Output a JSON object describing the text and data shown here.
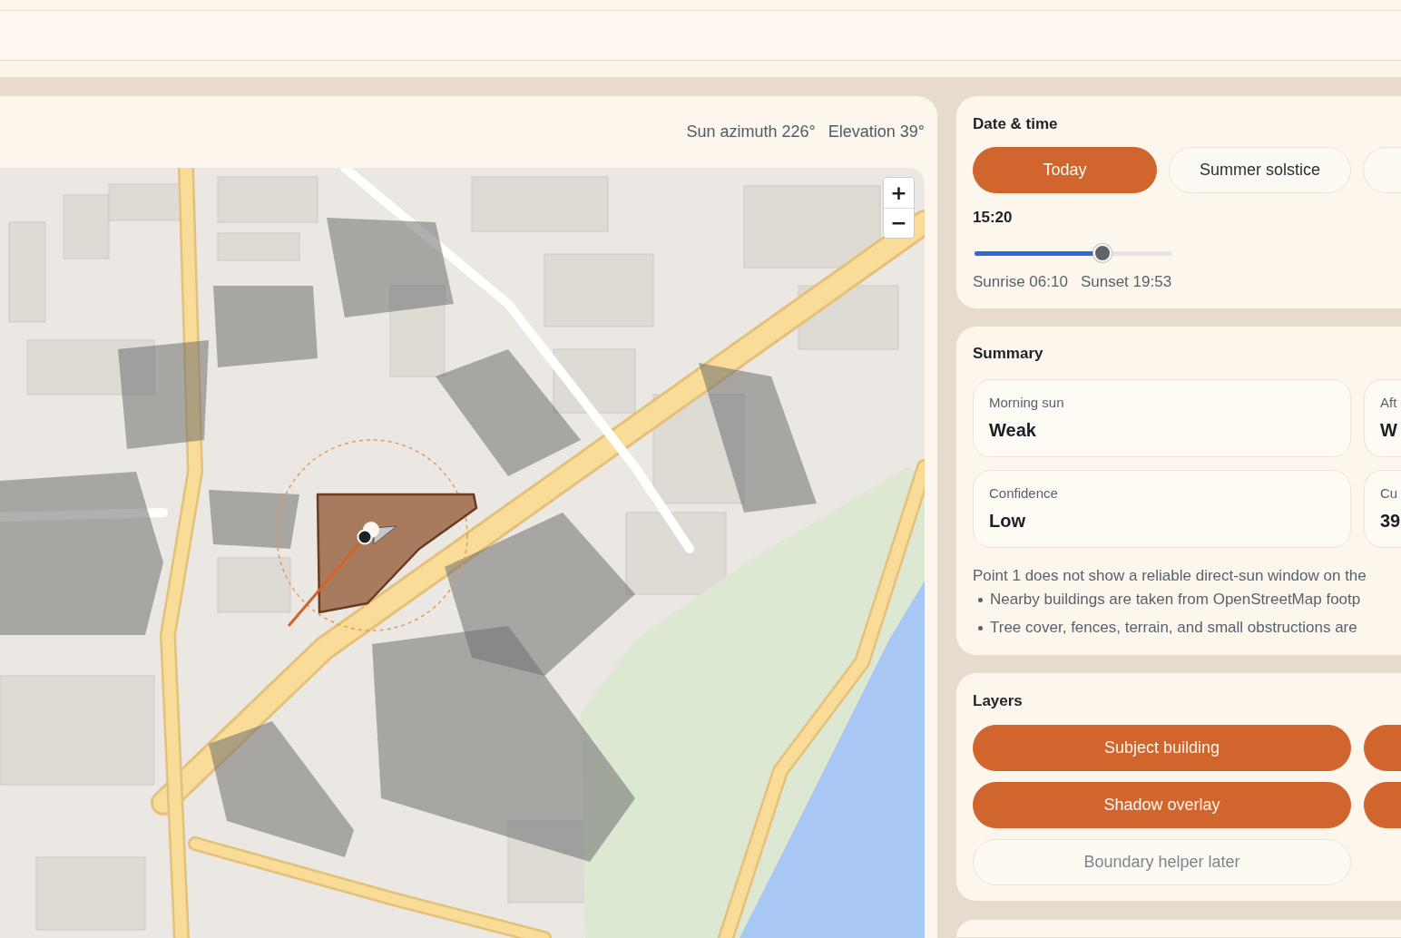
{
  "map_panel": {
    "sun_azimuth": "Sun azimuth 226°",
    "elevation": "Elevation 39°",
    "zoom_controls": [
      {
        "label": "+"
      },
      {
        "label": "−"
      }
    ]
  },
  "date_time": {
    "title": "Date & time",
    "presets": [
      {
        "label": "Today",
        "selected": true
      },
      {
        "label": "Summer solstice",
        "selected": false
      },
      {
        "selected": false
      }
    ],
    "time": "15:20",
    "time_slider": {
      "level": 0.65
    },
    "sunrise": "Sunrise 06:10",
    "sunset": "Sunset 19:53"
  },
  "summary": {
    "title": "Summary",
    "tiles": [
      {
        "label": "Morning sun",
        "value": "Weak"
      },
      {
        "label": "Aft",
        "value": "W"
      },
      {
        "label": "Confidence",
        "value": "Low"
      },
      {
        "label": "Cu",
        "value": "39"
      }
    ],
    "note": "Point 1 does not show a reliable direct-sun window on the",
    "bullets": [
      "Nearby buildings are taken from OpenStreetMap footp",
      "Tree cover, fences, terrain, and small obstructions are"
    ]
  },
  "layers": {
    "title": "Layers",
    "toggles": [
      {
        "label": "Subject building",
        "on": true,
        "disabled": false
      },
      {
        "on": true,
        "disabled": false
      },
      {
        "label": "Shadow overlay",
        "on": true,
        "disabled": false
      },
      {
        "on": true,
        "disabled": false
      },
      {
        "label": "Boundary helper later",
        "on": false,
        "disabled": true
      }
    ]
  }
}
